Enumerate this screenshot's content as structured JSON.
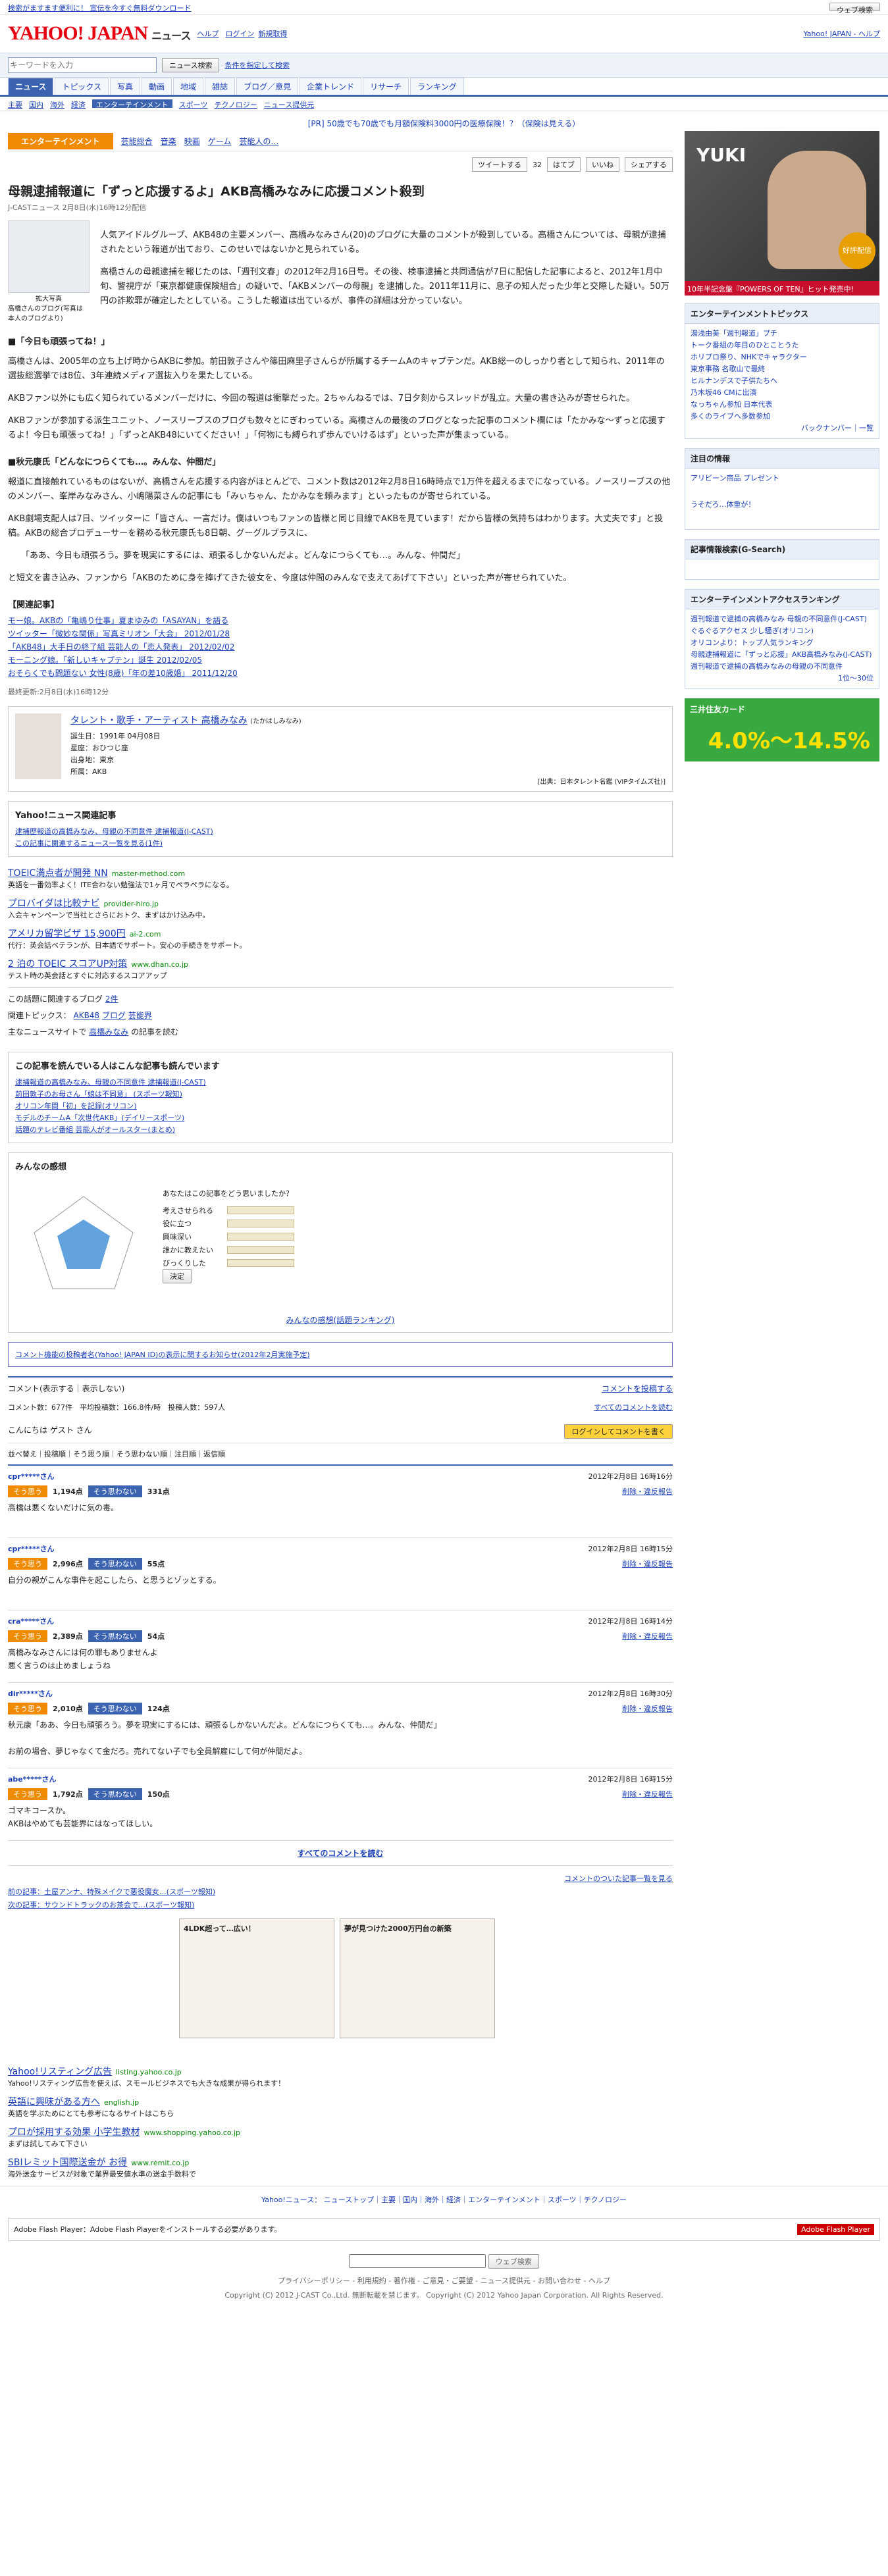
{
  "topbar": {
    "left": "検索がますます便利に！ 宣伝を今すぐ無料ダウンロード",
    "right_search_button": "ウェブ検索"
  },
  "header": {
    "logo": "YAHOO! JAPAN",
    "service": "ニュース",
    "help": "ヘルプ",
    "login": "ログイン",
    "register": "新規取得",
    "top_link": "Yahoo! JAPAN - ヘルプ"
  },
  "search": {
    "placeholder": "キーワードを入力",
    "button": "ニュース検索",
    "advanced": "条件を指定して検索"
  },
  "nav": {
    "tabs": [
      "ニュース",
      "トピックス",
      "写真",
      "動画",
      "地域",
      "雑誌",
      "ブログ／意見",
      "企業トレンド",
      "リサーチ",
      "ランキング"
    ],
    "active_index": 0
  },
  "subnav": {
    "items": [
      "主要",
      "国内",
      "海外",
      "経済",
      "エンターテインメント",
      "スポーツ",
      "テクノロジー",
      "ニュース提供元"
    ],
    "active_index": 4
  },
  "notice": "[PR] 50歳でも70歳でも月額保険料3000円の医療保険！？（保険は見える）",
  "category": {
    "label": "エンターテインメント",
    "links": [
      "芸能総合",
      "音楽",
      "映画",
      "ゲーム",
      "芸能人の…"
    ]
  },
  "share": {
    "tweet": "ツイートする",
    "count": "32",
    "hatena": "はてブ",
    "like": "いいね",
    "share_btn": "シェアする"
  },
  "article": {
    "title": "母親逮捕報道に「ずっと応援するよ」AKB高橋みなみに応援コメント殺到",
    "meta": "J-CASTニュース 2月8日(水)16時12分配信",
    "photo_caption": "拡大写真",
    "photo_sub": "高橋さんのブログ(写真は本人のブログより)",
    "paragraphs": [
      "人気アイドルグループ、AKB48の主要メンバー、高橋みなみさん(20)のブログに大量のコメントが殺到している。高橋さんについては、母親が逮捕されたという報道が出ており、このせいではないかと見られている。",
      "高橋さんの母親逮捕を報じたのは、「週刊文春」の2012年2月16日号。その後、検事逮捕と共同通信が7日に配信した記事によると、2012年1月中旬、警視庁が「東京都健康保険組合」の疑いで、「AKBメンバーの母親」を逮捕した。2011年11月に、息子の知人だった少年と交際した疑い。50万円の詐欺罪が確定したとしている。こうした報道は出ているが、事件の詳細は分かっていない。",
      "高橋さんは、2005年の立ち上げ時からAKBに参加。前田敦子さんや篠田麻里子さんらが所属するチームAのキャプテンだ。AKB総一のしっかり者として知られ、2011年の選抜総選挙では8位、3年連続メディア選抜入りを果たしている。",
      "AKBファン以外にも広く知られているメンバーだけに、今回の報道は衝撃だった。2ちゃんねるでは、7日夕刻からスレッドが乱立。大量の書き込みが寄せられた。",
      "AKBファンが参加する派生ユニット、ノースリーブスのブログも数々とにぎわっている。高橋さんの最後のブログとなった記事のコメント欄には「たかみな～ずっと応援するよ！今日も頑張ってね！」「ずっとAKB48にいてください！」「何物にも縛られず歩んでいけるはず」といった声が集まっている。",
      "報道に直接触れているものはないが、高橋さんを応援する内容がほとんどで、コメント数は2012年2月8日16時時点で1万件を超えるまでになっている。ノースリーブスの他のメンバー、峯岸みなみさん、小嶋陽菜さんの記事にも「みぃちゃん、たかみなを頼みます」といったものが寄せられている。",
      "AKB劇場支配人は7日、ツイッターに「皆さん、一言だけ。僕はいつもファンの皆様と同じ目線でAKBを見ています！だから皆様の気持ちはわかります。大丈夫です」と投稿。AKBの総合プロデューサーを務める秋元康氏も8日朝、グーグルプラスに、",
      "「ああ、今日も頑張ろう。夢を現実にするには、頑張るしかないんだよ。どんなにつらくても…。みんな、仲間だ」",
      "と短文を書き込み、ファンから「AKBのために身を捧げてきた彼女を、今度は仲間のみんなで支えてあげて下さい」といった声が寄せられていた。"
    ],
    "section1": "■「今日も頑張ってね！」",
    "section2": "■秋元康氏「どんなにつらくても…。みんな、仲間だ」"
  },
  "related": {
    "title": "【関連記事】",
    "items": [
      "モー娘。AKBの「亀嶋り仕事」夏まゆみの「ASAYAN」を語る",
      "ツイッター「微妙な関係」写真ミリオン「大会」 2012/01/28",
      "「AKB48」大手日の終了組 芸能人の「恋人発表」 2012/02/02",
      "モーニング娘。「新しいキャプテン」誕生 2012/02/05",
      "おそらくでも問題ない 女性(8歳)「年の差10歳婚」 2011/12/20"
    ],
    "footer": "最終更新:2月8日(水)16時12分"
  },
  "talent": {
    "title": "タレント・歌手・アーティスト 高橋みなみ",
    "kana": "(たかはしみなみ)",
    "details": [
      "誕生日：1991年 04月08日",
      "星座：おひつじ座",
      "出身地：東京",
      "所属：AKB"
    ],
    "source": "[出典：日本タレント名鑑 (VIPタイムズ社)]"
  },
  "yahoo_related": {
    "title": "Yahoo!ニュース関連記事",
    "items": [
      "逮捕歴報道の高橋みなみ、母親の不同意件 逮捕報道(J-CAST)",
      "この記事に関連するニュース一覧を見る(1件)"
    ]
  },
  "ads1": [
    {
      "title": "TOEIC満点者が開発 NN",
      "url": "master-method.com",
      "desc": "英語を一番効率よく！ITE合わない勉強法で1ヶ月でペラペラになる。"
    },
    {
      "title": "プロバイダは比較ナビ",
      "url": "provider-hiro.jp",
      "desc": "入会キャンペーンで当社とさらにおトク、まずはかけ込み中。"
    },
    {
      "title": "アメリカ留学ビザ 15,900円",
      "url": "ai-2.com",
      "desc": "代行：英会話ベテランが、日本語でサポート。安心の手続きをサポート。"
    },
    {
      "title": "2 泊の TOEIC スコアUP対策",
      "url": "www.dhan.co.jp",
      "desc": "テスト時の英会話とすぐに対応するスコアアップ"
    }
  ],
  "blog_link": {
    "label": "この話題に関連するブログ",
    "count": "2件"
  },
  "topics": {
    "label": "関連トピックス",
    "items": [
      "AKB48",
      "ブログ",
      "芸能界"
    ]
  },
  "sources": {
    "label": "主なニュースサイトで",
    "keyword": "高橋みなみ",
    "suffix": "の記事を読む"
  },
  "also_read": {
    "title": "この記事を読んでいる人はこんな記事も読んでいます",
    "items": [
      "逮捕報道の高橋みなみ、母親の不同意件 逮捕報道(J-CAST)",
      "前田敦子のお母さん「娘は不同意」 (スポーツ報知)",
      "オリコン年間「初」を記録(オリコン)",
      "モデルのチームA「次世代AKB」(デイリースポーツ)",
      "話題のテレビ番組 芸能人がオールスター(まとめ)"
    ]
  },
  "impression": {
    "title": "みんなの感想",
    "labels": [
      "考えさせられる",
      "役に立つ",
      "興味深い",
      "誰かに教えたい",
      "びっくりした"
    ],
    "question": "あなたはこの記事をどう思いましたか？",
    "decide": "決定",
    "link": "みんなの感想(話題ランキング)"
  },
  "comment_notice": "コメント機能の投稿者名(Yahoo! JAPAN ID)の表示に関するお知らせ(2012年2月実施予定)",
  "comments": {
    "header": "コメント(表示する｜表示しない)",
    "post": "コメントを投稿する",
    "stats": "コメント数：677件　平均投稿数：166.8件/時　投稿人数：597人",
    "all_link": "すべてのコメントを読む",
    "greeting": "こんにちは ゲスト さん",
    "login_btn": "ログインしてコメントを書く",
    "sort": "並べ替え｜投稿順｜そう思う順｜そう思わない順｜注目順｜返信順",
    "list": [
      {
        "user": "cpr*****さん",
        "date": "2012年2月8日 16時16分",
        "agree": "1,194点",
        "disagree": "331点",
        "text": "高橋は悪くないだけに気の毒。",
        "report": "削除・違反報告"
      },
      {
        "user": "cpr*****さん",
        "date": "2012年2月8日 16時15分",
        "agree": "2,996点",
        "disagree": "55点",
        "text": "自分の親がこんな事件を起こしたら、と思うとゾッとする。",
        "report": "削除・違反報告"
      },
      {
        "user": "cra*****さん",
        "date": "2012年2月8日 16時14分",
        "agree": "2,389点",
        "disagree": "54点",
        "text": "高橋みなみさんには何の罪もありませんよ\n悪く言うのは止めましょうね",
        "report": "削除・違反報告"
      },
      {
        "user": "dir*****さん",
        "date": "2012年2月8日 16時30分",
        "agree": "2,010点",
        "disagree": "124点",
        "text": "秋元康「ああ、今日も頑張ろう。夢を現実にするには、頑張るしかないんだよ。どんなにつらくても…。みんな、仲間だ」\n\nお前の場合、夢じゃなくて金だろ。売れてない子でも全員解雇にして何が仲間だよ。",
        "report": "削除・違反報告"
      },
      {
        "user": "abe*****さん",
        "date": "2012年2月8日 16時15分",
        "agree": "1,792点",
        "disagree": "150点",
        "text": "ゴマキコースか。\nAKBはやめても芸能界にはなってほしい。",
        "report": "削除・違反報告"
      }
    ]
  },
  "prev_next": {
    "prev": "前の記事：土屋アンナ、特殊メイクで悪役魔女…(スポーツ報知)",
    "next": "次の記事：サウンドトラックのお茶会で…(スポーツ報知)",
    "list_link": "コメントのついた記事一覧を見る"
  },
  "dual_ads": {
    "left": "4LDK超って…広い！",
    "right": "夢が見つけた2000万円台の新築"
  },
  "ads2": [
    {
      "title": "Yahoo!リスティング広告",
      "url": "listing.yahoo.co.jp",
      "desc": "Yahoo!リスティング広告を使えば、スモールビジネスでも大きな成果が得られます！"
    },
    {
      "title": "英語に興味がある方へ",
      "url": "english.jp",
      "desc": "英語を学ぶためにとても参考になるサイトはこちら"
    },
    {
      "title": "プロが採用する効果 小学生教材",
      "url": "www.shopping.yahoo.co.jp",
      "desc": "まずは試してみて下さい"
    },
    {
      "title": "SBIレミット国際送金が お得",
      "url": "www.remit.co.jp",
      "desc": "海外送金サービスが対象で業界最安値水準の送金手数料で"
    }
  ],
  "footer_nav": "Yahoo!ニュース： ニューストップ｜主要｜国内｜海外｜経済｜エンターテインメント｜スポーツ｜テクノロジー",
  "flash": {
    "text": "Adobe Flash Player：Adobe Flash Playerをインストールする必要があります。",
    "badge": "Adobe Flash Player"
  },
  "footer": {
    "search_button": "ウェブ検索",
    "links": "プライバシーポリシー - 利用規約 - 著作権 - ご意見・ご要望 - ニュース提供元 - お問い合わせ - ヘルプ",
    "copyright": "Copyright (C) 2012 J-CAST Co.,Ltd. 無断転載を禁じます。 Copyright (C) 2012 Yahoo Japan Corporation. All Rights Reserved."
  },
  "side": {
    "ad_top": {
      "name": "YUKI",
      "badge": "好評配信中!",
      "foot": "10年半記念盤『POWERS OF TEN』ヒット発売中!"
    },
    "topics": {
      "title": "エンターテインメントトピックス",
      "items": [
        "湯浅由美「週刊報道」プチ",
        "トーク番組の年目のひとことうた",
        "ホリプロ祭り、NHKでキャラクター",
        "東京事務 名歌山で最終",
        "ヒルナンデスで子供たちへ",
        "乃木坂46 CMに出演",
        "なっちゃん参加 日本代表",
        "多くのライブへ多数参加"
      ],
      "more": "バックナンバー｜一覧"
    },
    "attention": {
      "title": "注目の情報",
      "items": [
        "アリビーン商品 プレゼント",
        "うそだろ…体重が！"
      ]
    },
    "search_rank": {
      "title": "記事情報検索(G-Search)"
    },
    "access_rank": {
      "title": "エンターテインメントアクセスランキング",
      "items": [
        "週刊報道で逮捕の高橋みなみ 母親の不同意件(J-CAST)",
        "ぐるぐるアクセス 少し騒ぎ(オリコン)",
        "オリコンより：トップ人気ランキング",
        "母親逮捕報道に「ずっと応援」AKB高橋みなみ(J-CAST)",
        "週刊報道で逮捕の高橋みなみの母親の不同意件"
      ],
      "more": "1位〜30位"
    },
    "card_ad": {
      "title": "三井住友カード",
      "rate": "4.0%〜14.5%"
    }
  }
}
